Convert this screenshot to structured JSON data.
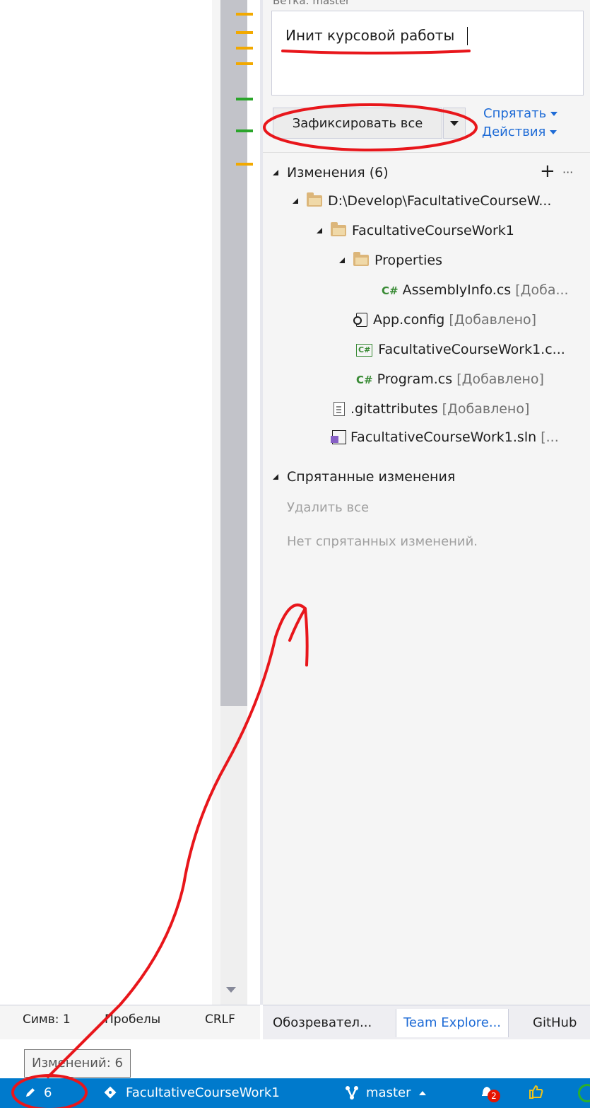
{
  "commit": {
    "branch_label": "Ветка: master",
    "message": "Инит курсовой работы",
    "commit_button_label": "Зафиксировать все",
    "links": {
      "stash": "Спрятать",
      "actions": "Действия"
    }
  },
  "changes": {
    "header": "Изменения (6)",
    "add_symbol": "+",
    "more_symbol": "···",
    "tree": [
      {
        "text": "D:\\Develop\\FacultativeCourseW...",
        "tag": ""
      },
      {
        "text": "FacultativeCourseWork1",
        "tag": ""
      },
      {
        "text": "Properties",
        "tag": ""
      },
      {
        "text": "AssemblyInfo.cs",
        "tag": "[Доба..."
      },
      {
        "text": "App.config",
        "tag": "[Добавлено]"
      },
      {
        "text": "FacultativeCourseWork1.c...",
        "tag": ""
      },
      {
        "text": "Program.cs",
        "tag": "[Добавлено]"
      },
      {
        "text": ".gitattributes",
        "tag": "[Добавлено]"
      },
      {
        "text": "FacultativeCourseWork1.sln",
        "tag": "[..."
      }
    ]
  },
  "stashes": {
    "header": "Спрятанные изменения",
    "delete_all": "Удалить все",
    "empty": "Нет спрятанных изменений."
  },
  "tabs": [
    "Обозревател...",
    "Team Explore...",
    "GitHub"
  ],
  "editor_status": {
    "col": "Симв: 1",
    "spaces": "Пробелы",
    "eol": "CRLF"
  },
  "tooltip": "Изменений: 6",
  "status_bar": {
    "pending_changes": "6",
    "repository": "FacultativeCourseWork1",
    "branch": "master",
    "notifications": "2"
  },
  "icons": {
    "csharp": "c-sharp-icon",
    "folder": "folder-icon",
    "pencil": "pencil-icon",
    "repo": "git-repo-icon",
    "branch": "branch-icon",
    "bell": "notification-bell-icon"
  },
  "colors": {
    "status_bar": "#007acc",
    "link": "#1e6bd6",
    "annotation": "#e8161b"
  }
}
